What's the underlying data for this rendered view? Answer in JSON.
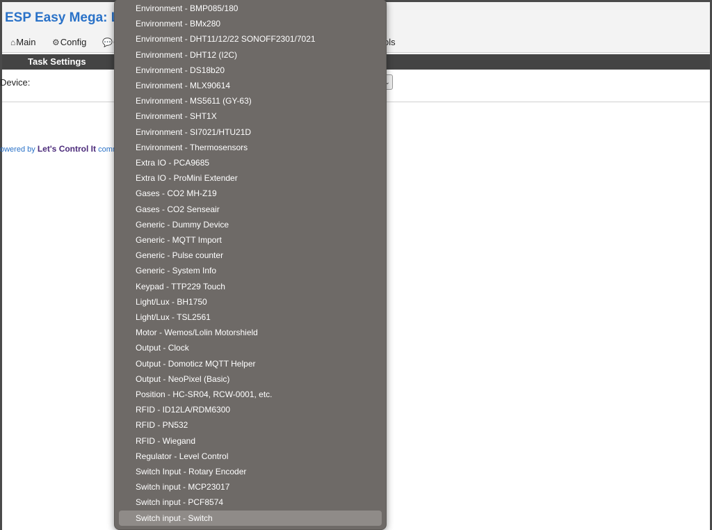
{
  "app": {
    "title": "ESP Easy Mega: LCD"
  },
  "nav": [
    {
      "icon": "⌂",
      "label": "Main"
    },
    {
      "icon": "⚙",
      "label": "Config"
    },
    {
      "icon": "💬",
      "label": "C"
    },
    {
      "icon": "",
      "label": "ols"
    }
  ],
  "task_settings": {
    "title": "Task Settings"
  },
  "device": {
    "label": "Device:"
  },
  "footer": {
    "prefix": "owered by",
    "brand": "Let's Control It",
    "suffix": "comm"
  },
  "dropdown": {
    "options": [
      "Environment - BMP085/180",
      "Environment - BMx280",
      "Environment - DHT11/12/22 SONOFF2301/7021",
      "Environment - DHT12 (I2C)",
      "Environment - DS18b20",
      "Environment - MLX90614",
      "Environment - MS5611 (GY-63)",
      "Environment - SHT1X",
      "Environment - SI7021/HTU21D",
      "Environment - Thermosensors",
      "Extra IO - PCA9685",
      "Extra IO - ProMini Extender",
      "Gases - CO2 MH-Z19",
      "Gases - CO2 Senseair",
      "Generic - Dummy Device",
      "Generic - MQTT Import",
      "Generic - Pulse counter",
      "Generic - System Info",
      "Keypad - TTP229 Touch",
      "Light/Lux - BH1750",
      "Light/Lux - TSL2561",
      "Motor - Wemos/Lolin Motorshield",
      "Output - Clock",
      "Output - Domoticz MQTT Helper",
      "Output - NeoPixel (Basic)",
      "Position - HC-SR04, RCW-0001, etc.",
      "RFID - ID12LA/RDM6300",
      "RFID - PN532",
      "RFID - Wiegand",
      "Regulator - Level Control",
      "Switch Input - Rotary Encoder",
      "Switch input - MCP23017",
      "Switch input - PCF8574",
      "Switch input - Switch"
    ],
    "selected_index": 33
  }
}
